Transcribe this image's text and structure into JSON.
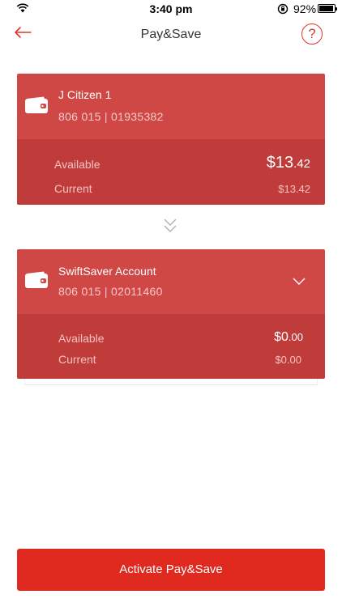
{
  "status_bar": {
    "time": "3:40 pm",
    "battery_percent": "92%"
  },
  "nav": {
    "title": "Pay&Save",
    "help_label": "?"
  },
  "from_account": {
    "name": "J Citizen 1",
    "number": "806 015 | 01935382",
    "available_label": "Available",
    "available_dollars": "$13",
    "available_cents": ".42",
    "current_label": "Current",
    "current_value": "$13.42"
  },
  "to_account": {
    "name": "SwiftSaver Account",
    "number": "806 015 | 02011460",
    "available_label": "Available",
    "available_dollars": "$0",
    "available_cents": ".00",
    "current_label": "Current",
    "current_value": "$0.00"
  },
  "actions": {
    "activate_label": "Activate Pay&Save"
  },
  "colors": {
    "accent": "#e02a1f",
    "card_top": "#d04846",
    "card_bottom": "#c03c3b"
  }
}
